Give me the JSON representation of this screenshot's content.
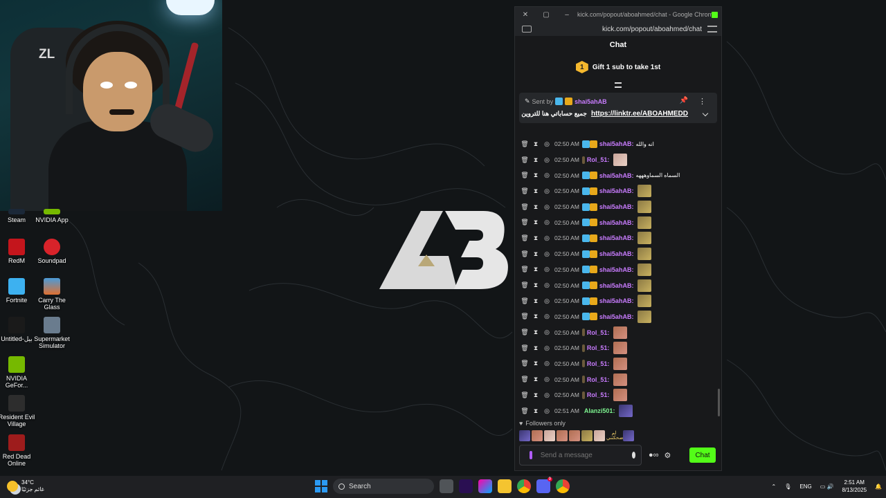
{
  "popup": {
    "window_title": "kick.com/popout/aboahmed/chat - Google Chrome",
    "url": "kick.com/popout/aboahmed/chat",
    "chat_heading": "Chat",
    "gift_count": "1",
    "gift_text": "Gift 1 sub to take 1st",
    "pinned": {
      "sent_by": "Sent by",
      "username": "shai5ahAB",
      "arabic_text": "جميع حساباتي هنا للتروين",
      "link": "https://linktr.ee/ABOAHMEDD"
    },
    "messages": [
      {
        "time": "02:50 AM",
        "user": "shai5ahAB:",
        "text": "انه والله",
        "emote": ""
      },
      {
        "time": "02:50 AM",
        "user": "Rol_51:",
        "text": "",
        "emote": "face"
      },
      {
        "time": "02:50 AM",
        "user": "shai5ahAB:",
        "text": "السماه السماوهههه",
        "emote": ""
      },
      {
        "time": "02:50 AM",
        "user": "shai5ahAB:",
        "text": "",
        "emote": "gold"
      },
      {
        "time": "02:50 AM",
        "user": "shai5ahAB:",
        "text": "",
        "emote": "gold"
      },
      {
        "time": "02:50 AM",
        "user": "shai5ahAB:",
        "text": "",
        "emote": "gold"
      },
      {
        "time": "02:50 AM",
        "user": "shai5ahAB:",
        "text": "",
        "emote": "gold"
      },
      {
        "time": "02:50 AM",
        "user": "shai5ahAB:",
        "text": "",
        "emote": "gold"
      },
      {
        "time": "02:50 AM",
        "user": "shai5ahAB:",
        "text": "",
        "emote": "gold"
      },
      {
        "time": "02:50 AM",
        "user": "shai5ahAB:",
        "text": "",
        "emote": "gold"
      },
      {
        "time": "02:50 AM",
        "user": "shai5ahAB:",
        "text": "",
        "emote": "gold"
      },
      {
        "time": "02:50 AM",
        "user": "shai5ahAB:",
        "text": "",
        "emote": "gold"
      },
      {
        "time": "02:50 AM",
        "user": "Rol_51:",
        "text": "",
        "emote": "pink"
      },
      {
        "time": "02:50 AM",
        "user": "Rol_51:",
        "text": "",
        "emote": "pink"
      },
      {
        "time": "02:50 AM",
        "user": "Rol_51:",
        "text": "",
        "emote": "pink"
      },
      {
        "time": "02:50 AM",
        "user": "Rol_51:",
        "text": "",
        "emote": "pink"
      },
      {
        "time": "02:50 AM",
        "user": "Rol_51:",
        "text": "",
        "emote": "pink"
      },
      {
        "time": "02:51 AM",
        "user": "Alanzi501:",
        "text": "",
        "emote": "purple"
      }
    ],
    "followers_only": "Followers only",
    "emote_bar_text": "لم ضحكتني",
    "input_placeholder": "Send a message",
    "chat_button": "Chat"
  },
  "webcam": {
    "wall_text": "ZL"
  },
  "desktop_icons": [
    {
      "label": "Steam"
    },
    {
      "label": "NVIDIA App"
    },
    {
      "label": "RedM"
    },
    {
      "label": "Soundpad"
    },
    {
      "label": "Fortnite"
    },
    {
      "label": "Carry The Glass"
    },
    {
      "label": "Untitled-بيل"
    },
    {
      "label": "Supermarket Simulator"
    },
    {
      "label": "NVIDIA GeFor..."
    },
    {
      "label": "Resident Evil Village"
    },
    {
      "label": "Red Dead Online"
    }
  ],
  "taskbar": {
    "temperature": "34°C",
    "weather_text": "غائم جزئيًا",
    "search": "Search",
    "lang": "ENG",
    "time": "2:51 AM",
    "date": "8/13/2025",
    "discord_badge": "9"
  },
  "colors": {
    "kick_green": "#53fc18",
    "user_purple": "#c97cff",
    "user_green": "#7cf28f",
    "user_blue": "#75c4ff"
  }
}
